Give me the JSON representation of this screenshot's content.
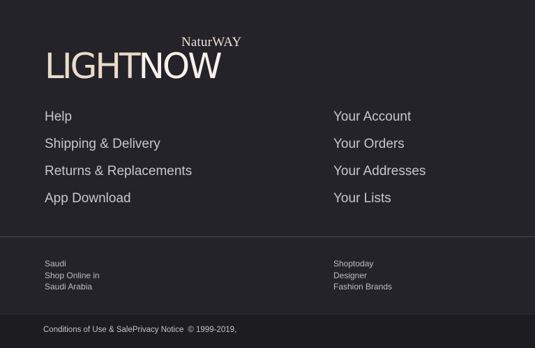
{
  "brand": {
    "sub": "NaturWAY",
    "main_light": "LIGHT",
    "main_now": "NOW"
  },
  "help_links": [
    "Help",
    "Shipping & Delivery",
    "Returns & Replacements",
    "App Download"
  ],
  "account_links": [
    "Your Account",
    "Your Orders",
    "Your Addresses",
    "Your Lists"
  ],
  "info_left": [
    "Saudi",
    "Shop Online in",
    "Saudi Arabia"
  ],
  "info_right": [
    "Shoptoday",
    "Designer",
    "Fashion Brands"
  ],
  "legal": {
    "conditions": "Conditions of Use & Sale",
    "privacy": "Privacy Notice",
    "copyright": "© 1999-2019,"
  },
  "colors": {
    "background": "#232329",
    "footer_bar": "#1c1c21",
    "logo_light": "#eadbc9",
    "logo_now": "#f7f1ea"
  }
}
